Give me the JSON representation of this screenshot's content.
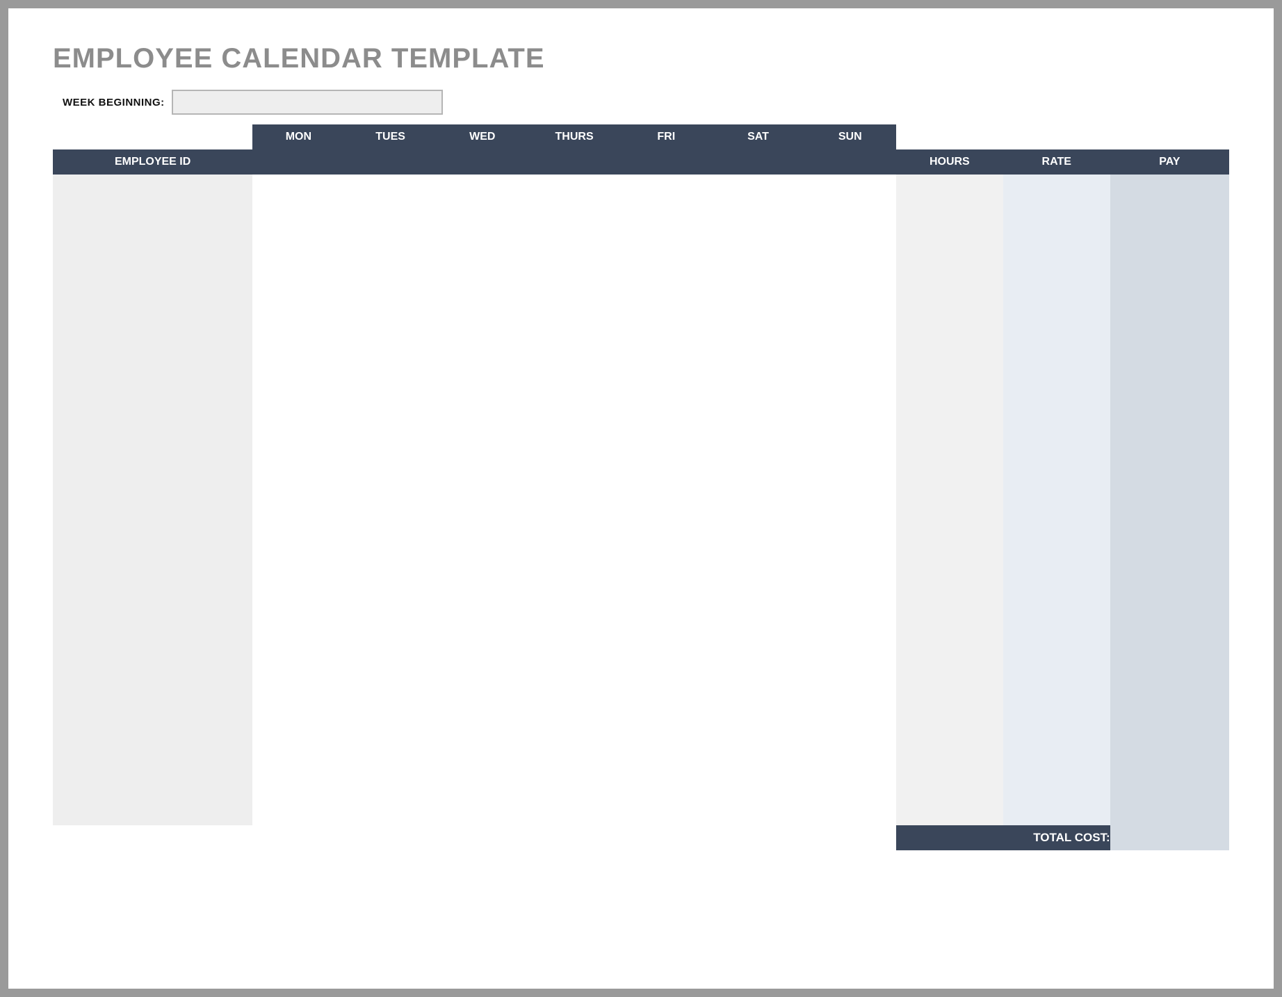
{
  "title": "EMPLOYEE CALENDAR TEMPLATE",
  "week_beginning_label": "WEEK BEGINNING:",
  "week_beginning_value": "",
  "days": [
    "MON",
    "TUES",
    "WED",
    "THURS",
    "FRI",
    "SAT",
    "SUN"
  ],
  "columns": {
    "employee_id": "EMPLOYEE ID",
    "hours": "HOURS",
    "rate": "RATE",
    "pay": "PAY"
  },
  "rows": [
    {
      "employee_id": "",
      "mon": "",
      "tues": "",
      "wed": "",
      "thurs": "",
      "fri": "",
      "sat": "",
      "sun": "",
      "hours": "",
      "rate": "",
      "pay": ""
    },
    {
      "employee_id": "",
      "mon": "",
      "tues": "",
      "wed": "",
      "thurs": "",
      "fri": "",
      "sat": "",
      "sun": "",
      "hours": "",
      "rate": "",
      "pay": ""
    },
    {
      "employee_id": "",
      "mon": "",
      "tues": "",
      "wed": "",
      "thurs": "",
      "fri": "",
      "sat": "",
      "sun": "",
      "hours": "",
      "rate": "",
      "pay": ""
    },
    {
      "employee_id": "",
      "mon": "",
      "tues": "",
      "wed": "",
      "thurs": "",
      "fri": "",
      "sat": "",
      "sun": "",
      "hours": "",
      "rate": "",
      "pay": ""
    },
    {
      "employee_id": "",
      "mon": "",
      "tues": "",
      "wed": "",
      "thurs": "",
      "fri": "",
      "sat": "",
      "sun": "",
      "hours": "",
      "rate": "",
      "pay": ""
    },
    {
      "employee_id": "",
      "mon": "",
      "tues": "",
      "wed": "",
      "thurs": "",
      "fri": "",
      "sat": "",
      "sun": "",
      "hours": "",
      "rate": "",
      "pay": ""
    },
    {
      "employee_id": "",
      "mon": "",
      "tues": "",
      "wed": "",
      "thurs": "",
      "fri": "",
      "sat": "",
      "sun": "",
      "hours": "",
      "rate": "",
      "pay": ""
    },
    {
      "employee_id": "",
      "mon": "",
      "tues": "",
      "wed": "",
      "thurs": "",
      "fri": "",
      "sat": "",
      "sun": "",
      "hours": "",
      "rate": "",
      "pay": ""
    },
    {
      "employee_id": "",
      "mon": "",
      "tues": "",
      "wed": "",
      "thurs": "",
      "fri": "",
      "sat": "",
      "sun": "",
      "hours": "",
      "rate": "",
      "pay": ""
    },
    {
      "employee_id": "",
      "mon": "",
      "tues": "",
      "wed": "",
      "thurs": "",
      "fri": "",
      "sat": "",
      "sun": "",
      "hours": "",
      "rate": "",
      "pay": ""
    },
    {
      "employee_id": "",
      "mon": "",
      "tues": "",
      "wed": "",
      "thurs": "",
      "fri": "",
      "sat": "",
      "sun": "",
      "hours": "",
      "rate": "",
      "pay": ""
    },
    {
      "employee_id": "",
      "mon": "",
      "tues": "",
      "wed": "",
      "thurs": "",
      "fri": "",
      "sat": "",
      "sun": "",
      "hours": "",
      "rate": "",
      "pay": ""
    },
    {
      "employee_id": "",
      "mon": "",
      "tues": "",
      "wed": "",
      "thurs": "",
      "fri": "",
      "sat": "",
      "sun": "",
      "hours": "",
      "rate": "",
      "pay": ""
    },
    {
      "employee_id": "",
      "mon": "",
      "tues": "",
      "wed": "",
      "thurs": "",
      "fri": "",
      "sat": "",
      "sun": "",
      "hours": "",
      "rate": "",
      "pay": ""
    },
    {
      "employee_id": "",
      "mon": "",
      "tues": "",
      "wed": "",
      "thurs": "",
      "fri": "",
      "sat": "",
      "sun": "",
      "hours": "",
      "rate": "",
      "pay": ""
    },
    {
      "employee_id": "",
      "mon": "",
      "tues": "",
      "wed": "",
      "thurs": "",
      "fri": "",
      "sat": "",
      "sun": "",
      "hours": "",
      "rate": "",
      "pay": ""
    },
    {
      "employee_id": "",
      "mon": "",
      "tues": "",
      "wed": "",
      "thurs": "",
      "fri": "",
      "sat": "",
      "sun": "",
      "hours": "",
      "rate": "",
      "pay": ""
    },
    {
      "employee_id": "",
      "mon": "",
      "tues": "",
      "wed": "",
      "thurs": "",
      "fri": "",
      "sat": "",
      "sun": "",
      "hours": "",
      "rate": "",
      "pay": ""
    },
    {
      "employee_id": "",
      "mon": "",
      "tues": "",
      "wed": "",
      "thurs": "",
      "fri": "",
      "sat": "",
      "sun": "",
      "hours": "",
      "rate": "",
      "pay": ""
    },
    {
      "employee_id": "",
      "mon": "",
      "tues": "",
      "wed": "",
      "thurs": "",
      "fri": "",
      "sat": "",
      "sun": "",
      "hours": "",
      "rate": "",
      "pay": ""
    },
    {
      "employee_id": "",
      "mon": "",
      "tues": "",
      "wed": "",
      "thurs": "",
      "fri": "",
      "sat": "",
      "sun": "",
      "hours": "",
      "rate": "",
      "pay": ""
    },
    {
      "employee_id": "",
      "mon": "",
      "tues": "",
      "wed": "",
      "thurs": "",
      "fri": "",
      "sat": "",
      "sun": "",
      "hours": "",
      "rate": "",
      "pay": ""
    },
    {
      "employee_id": "",
      "mon": "",
      "tues": "",
      "wed": "",
      "thurs": "",
      "fri": "",
      "sat": "",
      "sun": "",
      "hours": "",
      "rate": "",
      "pay": ""
    },
    {
      "employee_id": "",
      "mon": "",
      "tues": "",
      "wed": "",
      "thurs": "",
      "fri": "",
      "sat": "",
      "sun": "",
      "hours": "",
      "rate": "",
      "pay": ""
    },
    {
      "employee_id": "",
      "mon": "",
      "tues": "",
      "wed": "",
      "thurs": "",
      "fri": "",
      "sat": "",
      "sun": "",
      "hours": "",
      "rate": "",
      "pay": ""
    },
    {
      "employee_id": "",
      "mon": "",
      "tues": "",
      "wed": "",
      "thurs": "",
      "fri": "",
      "sat": "",
      "sun": "",
      "hours": "",
      "rate": "",
      "pay": ""
    }
  ],
  "total_cost_label": "TOTAL COST:",
  "total_cost_value": ""
}
